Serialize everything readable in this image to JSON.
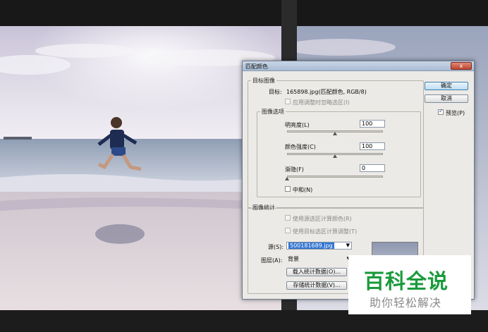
{
  "dialog": {
    "title": "匹配颜色",
    "close_symbol": "x",
    "target_group": {
      "legend": "目标图像",
      "target_label": "目标:",
      "target_value": "165898.jpg(匹配颜色, RGB/8)",
      "ignore_selection_label": "应用调整时忽略选区(I)"
    },
    "image_options": {
      "legend": "图像选项",
      "luminance_label": "明亮度(L)",
      "luminance_value": "100",
      "luminance_level": 0.5,
      "color_intensity_label": "颜色强度(C)",
      "color_intensity_value": "100",
      "color_intensity_level": 0.5,
      "fade_label": "渐隐(F)",
      "fade_value": "0",
      "fade_level": 0.0,
      "neutralize_label": "中和(N)"
    },
    "image_stats": {
      "legend": "图像统计",
      "use_source_selection_label": "使用源选区计算颜色(R)",
      "use_target_selection_label": "使用目标选区计算调整(T)",
      "source_label": "源(S):",
      "source_value": "500181689.jpg",
      "layer_label": "图层(A):",
      "layer_value": "背景",
      "load_stats_label": "载入统计数据(O)...",
      "save_stats_label": "存储统计数据(V)..."
    },
    "buttons": {
      "ok_label": "确定",
      "cancel_label": "取消",
      "preview_label": "预览(P)",
      "preview_checked": true
    }
  },
  "watermark": {
    "title": "百科全说",
    "subtitle": "助你轻松解决"
  }
}
